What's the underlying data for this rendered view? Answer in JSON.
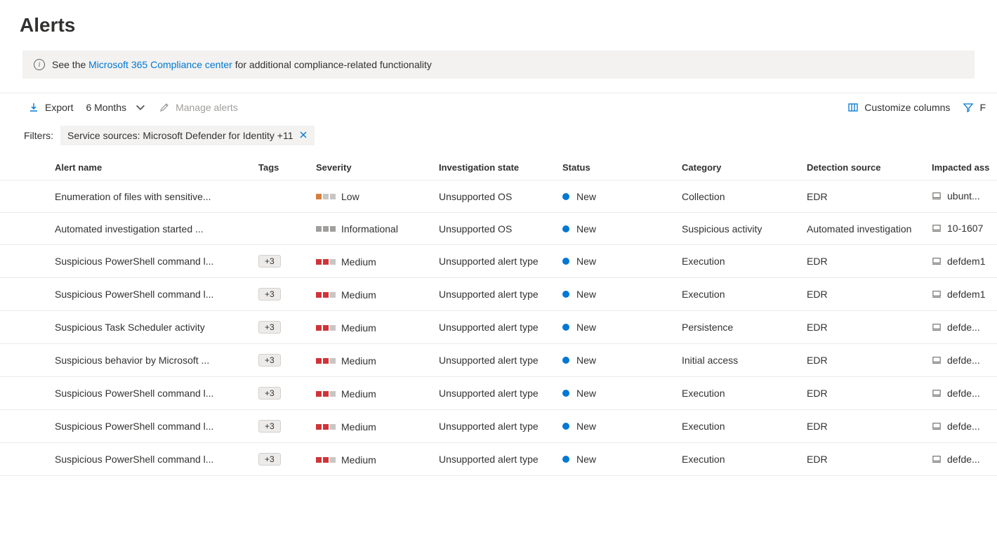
{
  "header": {
    "title": "Alerts"
  },
  "infobar": {
    "prefix": "See the ",
    "link": "Microsoft 365 Compliance center",
    "suffix": " for additional compliance-related functionality"
  },
  "toolbar": {
    "export_label": "Export",
    "range_label": "6 Months",
    "manage_label": "Manage alerts",
    "customize_label": "Customize columns",
    "filter_label": "F"
  },
  "filters": {
    "label": "Filters:",
    "chip_label": "Service sources: ",
    "chip_value": "Microsoft Defender for Identity +11"
  },
  "columns": {
    "name": "Alert name",
    "tags": "Tags",
    "severity": "Severity",
    "investigation": "Investigation state",
    "status": "Status",
    "category": "Category",
    "detection": "Detection source",
    "impacted": "Impacted ass"
  },
  "rows": [
    {
      "name": "Enumeration of files with sensitive...",
      "tag": "",
      "severity": "Low",
      "sev_class": "sev-low",
      "investigation": "Unsupported OS",
      "status": "New",
      "category": "Collection",
      "detection": "EDR",
      "asset": "ubunt..."
    },
    {
      "name": "Automated investigation started ...",
      "tag": "",
      "severity": "Informational",
      "sev_class": "sev-info",
      "investigation": "Unsupported OS",
      "status": "New",
      "category": "Suspicious activity",
      "detection": "Automated investigation",
      "asset": "10-1607"
    },
    {
      "name": "Suspicious PowerShell command l...",
      "tag": "+3",
      "severity": "Medium",
      "sev_class": "sev-medium",
      "investigation": "Unsupported alert type",
      "status": "New",
      "category": "Execution",
      "detection": "EDR",
      "asset": "defdem1"
    },
    {
      "name": "Suspicious PowerShell command l...",
      "tag": "+3",
      "severity": "Medium",
      "sev_class": "sev-medium",
      "investigation": "Unsupported alert type",
      "status": "New",
      "category": "Execution",
      "detection": "EDR",
      "asset": "defdem1"
    },
    {
      "name": "Suspicious Task Scheduler activity",
      "tag": "+3",
      "severity": "Medium",
      "sev_class": "sev-medium",
      "investigation": "Unsupported alert type",
      "status": "New",
      "category": "Persistence",
      "detection": "EDR",
      "asset": "defde..."
    },
    {
      "name": "Suspicious behavior by Microsoft ...",
      "tag": "+3",
      "severity": "Medium",
      "sev_class": "sev-medium",
      "investigation": "Unsupported alert type",
      "status": "New",
      "category": "Initial access",
      "detection": "EDR",
      "asset": "defde..."
    },
    {
      "name": "Suspicious PowerShell command l...",
      "tag": "+3",
      "severity": "Medium",
      "sev_class": "sev-medium",
      "investigation": "Unsupported alert type",
      "status": "New",
      "category": "Execution",
      "detection": "EDR",
      "asset": "defde..."
    },
    {
      "name": "Suspicious PowerShell command l...",
      "tag": "+3",
      "severity": "Medium",
      "sev_class": "sev-medium",
      "investigation": "Unsupported alert type",
      "status": "New",
      "category": "Execution",
      "detection": "EDR",
      "asset": "defde..."
    },
    {
      "name": "Suspicious PowerShell command l...",
      "tag": "+3",
      "severity": "Medium",
      "sev_class": "sev-medium",
      "investigation": "Unsupported alert type",
      "status": "New",
      "category": "Execution",
      "detection": "EDR",
      "asset": "defde..."
    }
  ]
}
